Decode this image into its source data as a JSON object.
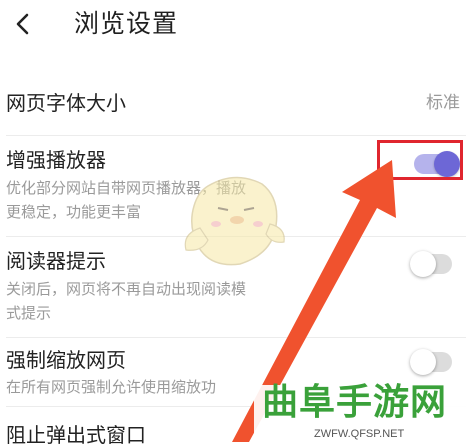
{
  "header": {
    "back_icon": "chevron-left-icon",
    "title": "浏览设置"
  },
  "settings": [
    {
      "title": "网页字体大小",
      "value": "标准"
    },
    {
      "title": "增强播放器",
      "description_line1": "优化部分网站自带网页播放器，播放",
      "description_line2": "更稳定，功能更丰富",
      "enabled": true
    },
    {
      "title": "阅读器提示",
      "description_line1": "关闭后，网页将不再自动出现阅读模",
      "description_line2": "式提示",
      "enabled": false
    },
    {
      "title": "强制缩放网页",
      "description_line1": "在所有网页强制允许使用缩放功",
      "enabled": false
    },
    {
      "title": "阻止弹出式窗口"
    }
  ],
  "annotations": {
    "highlight_color": "#e0262e",
    "arrow_color": "#f0522e"
  },
  "watermark": {
    "title": "曲阜手游网",
    "url": "ZWFW.QFSP.NET"
  },
  "colors": {
    "toggle_on": "#6d67d6",
    "toggle_on_track": "#b5b3ec",
    "toggle_off_track": "#dcdcdc"
  }
}
